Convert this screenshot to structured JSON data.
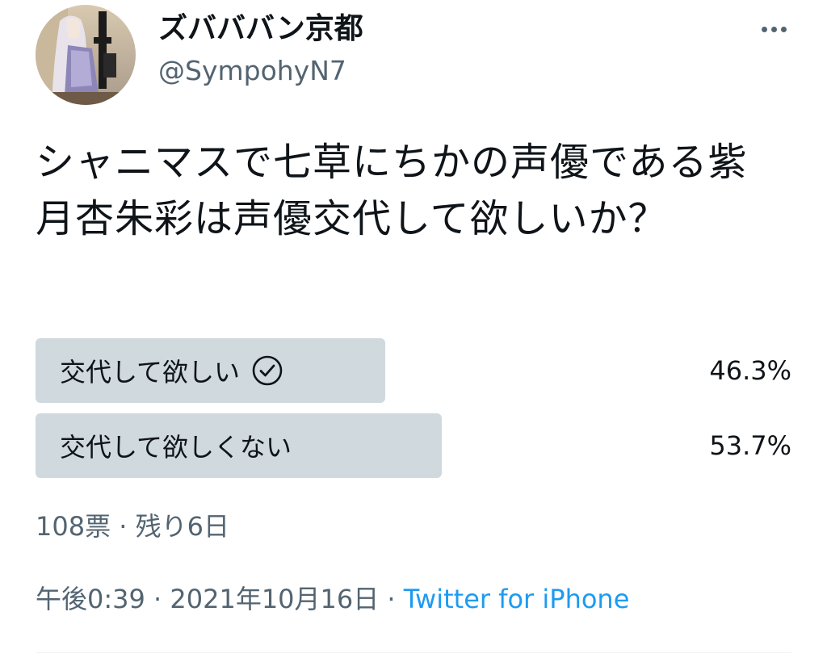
{
  "tweet": {
    "author": {
      "display_name": "ズバババン京都",
      "handle": "@SympohyN7",
      "avatar_icon": "anime-character-avatar-icon"
    },
    "more_icon": "more-horizontal-icon",
    "text": "シャニマスで七草にちかの声優である紫月杏朱彩は声優交代して欲しいか？"
  },
  "poll": {
    "options": [
      {
        "label": "交代して欲しい",
        "percent": "46.3%",
        "share": 0.463,
        "selected": true,
        "selected_icon": "check-circle-icon"
      },
      {
        "label": "交代して欲しくない",
        "percent": "53.7%",
        "share": 0.537,
        "selected": false
      }
    ],
    "meta": "108票 · 残り6日"
  },
  "timestamp": {
    "time_date": "午後0:39 · 2021年10月16日 · ",
    "source": "Twitter for iPhone"
  },
  "colors": {
    "text": "#0f1419",
    "secondary": "#536471",
    "bar": "#cfd9de",
    "accent": "#1d9bf0"
  }
}
